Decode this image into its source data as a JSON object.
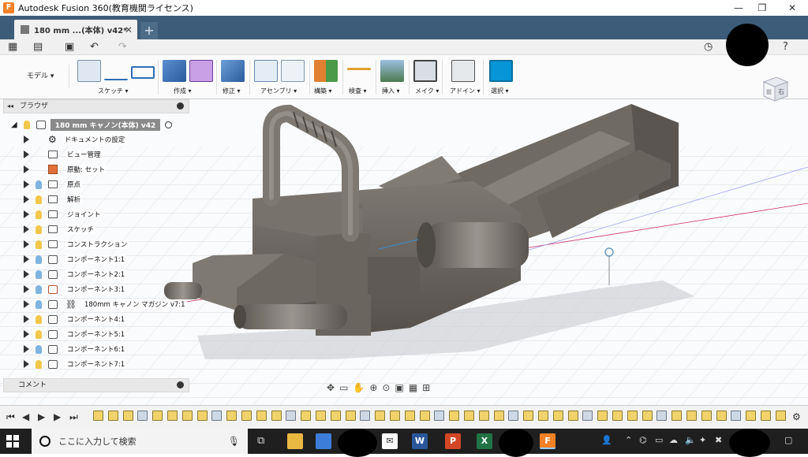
{
  "window": {
    "title": "Autodesk Fusion 360(教育機関ライセンス)",
    "logo_letter": "F",
    "minimize": "—",
    "maximize": "❐",
    "close": "✕"
  },
  "tabs": [
    {
      "label": "180 mm ...(本体) v42*",
      "close": "✕"
    }
  ],
  "new_tab": "+",
  "toolbar": {
    "workspace": "モデル ▾",
    "groups": [
      {
        "label": "スケッチ ▾"
      },
      {
        "label": "作成 ▾"
      },
      {
        "label": "修正 ▾"
      },
      {
        "label": "アセンブリ ▾"
      },
      {
        "label": "構築 ▾"
      },
      {
        "label": "検査 ▾"
      },
      {
        "label": "挿入 ▾"
      },
      {
        "label": "メイク ▾"
      },
      {
        "label": "アドイン ▾"
      },
      {
        "label": "選択 ▾"
      }
    ]
  },
  "browser": {
    "title": "ブラウザ",
    "root": "180 mm キャノン(本体) v42",
    "items": [
      {
        "label": "ドキュメントの設定",
        "icon": "gear-icon"
      },
      {
        "label": "ビュー管理",
        "icon": "folder-icon"
      },
      {
        "label": "原動: セット",
        "icon": "units-icon"
      },
      {
        "label": "原点",
        "icon": "folder-icon"
      },
      {
        "label": "解析",
        "icon": "folder-icon"
      },
      {
        "label": "ジョイント",
        "icon": "folder-icon"
      },
      {
        "label": "スケッチ",
        "icon": "folder-icon"
      },
      {
        "label": "コンストラクション",
        "icon": "folder-icon"
      },
      {
        "label": "コンポーネント1:1",
        "icon": "component-icon"
      },
      {
        "label": "コンポーネント2:1",
        "icon": "component-icon"
      },
      {
        "label": "コンポーネント3:1",
        "icon": "component-icon"
      },
      {
        "label": "180mm キャノン マガジン v7:1",
        "icon": "link-icon"
      },
      {
        "label": "コンポーネント4:1",
        "icon": "component-icon"
      },
      {
        "label": "コンポーネント5:1",
        "icon": "component-icon"
      },
      {
        "label": "コンポーネント6:1",
        "icon": "component-icon"
      },
      {
        "label": "コンポーネント7:1",
        "icon": "component-icon"
      }
    ]
  },
  "comments": {
    "title": "コメント"
  },
  "viewcube": {
    "front": "前",
    "right": "右"
  },
  "taskbar": {
    "search_placeholder": "ここに入力して検索"
  },
  "colors": {
    "tabbar": "#3d5c79",
    "model_body": "#6b6660",
    "bulb_on": "#f2c84b",
    "bulb_off": "#7fb4e0",
    "accent_select": "#0696d7"
  }
}
